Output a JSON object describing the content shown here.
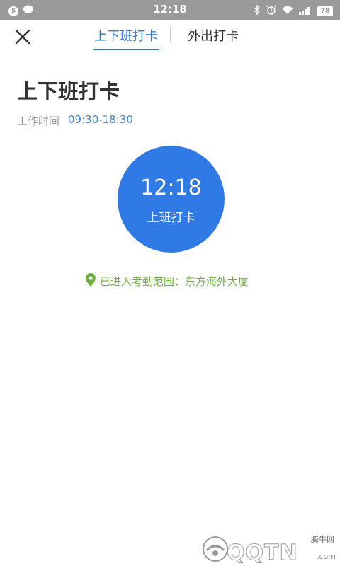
{
  "status_bar": {
    "left_badge": "5",
    "time": "12:18",
    "battery": "78",
    "icons": [
      "chat-bubble-icon",
      "bluetooth-icon",
      "alarm-icon",
      "wifi-icon",
      "signal-icon",
      "battery-icon"
    ]
  },
  "nav": {
    "close_icon": "close-icon",
    "tabs": [
      {
        "label": "上下班打卡",
        "active": true
      },
      {
        "label": "外出打卡",
        "active": false
      }
    ]
  },
  "main": {
    "title": "上下班打卡",
    "work_time_label": "工作时间",
    "work_time_value": "09:30-18:30",
    "punch_time": "12:18",
    "punch_label": "上班打卡",
    "location_icon": "location-pin-icon",
    "location_text": "已进入考勤范围：东方海外大厦"
  },
  "watermark": {
    "small_text": "腾牛网",
    "big_text": "QQTN",
    "suffix": ".com"
  },
  "colors": {
    "accent": "#2f7ae5",
    "location_green": "#6cb33f",
    "status_bar": "#9a9a9a"
  }
}
